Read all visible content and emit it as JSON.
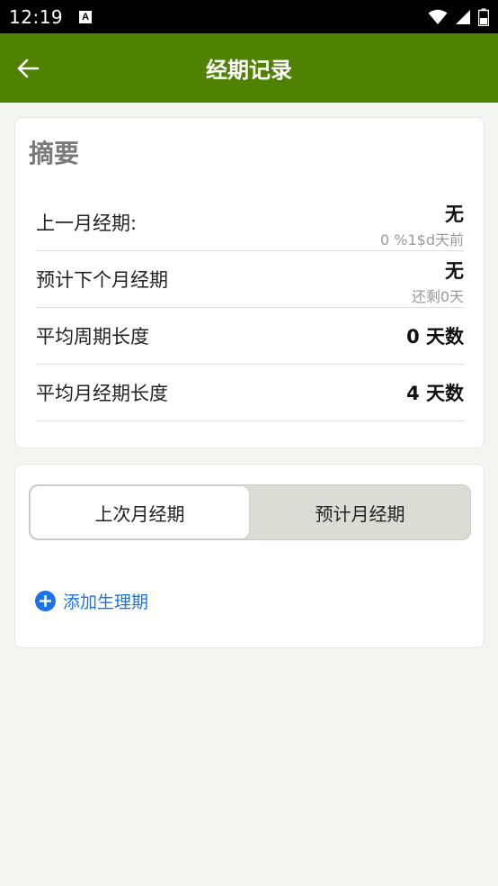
{
  "status_bar": {
    "time": "12:19",
    "notification_icon": "A",
    "icons": [
      "wifi-icon",
      "signal-icon",
      "battery-icon"
    ]
  },
  "app_bar": {
    "title": "经期记录",
    "back_icon": "arrow-left-icon"
  },
  "summary": {
    "title": "摘要",
    "rows": [
      {
        "label": "上一月经期:",
        "value": "无",
        "sub": "0 %1$d天前"
      },
      {
        "label": "预计下个月经期",
        "value": "无",
        "sub": "还剩0天"
      },
      {
        "label": "平均周期长度",
        "value": "0 天数"
      },
      {
        "label": "平均月经期长度",
        "value": "4 天数"
      }
    ]
  },
  "tabs": {
    "active": "上次月经期",
    "inactive": "预计月经期"
  },
  "add_period": {
    "label": "添加生理期",
    "icon": "plus-circle-icon"
  },
  "colors": {
    "app_bar": "#4e8200",
    "background": "#f3f6f0",
    "link": "#1a73e8"
  }
}
